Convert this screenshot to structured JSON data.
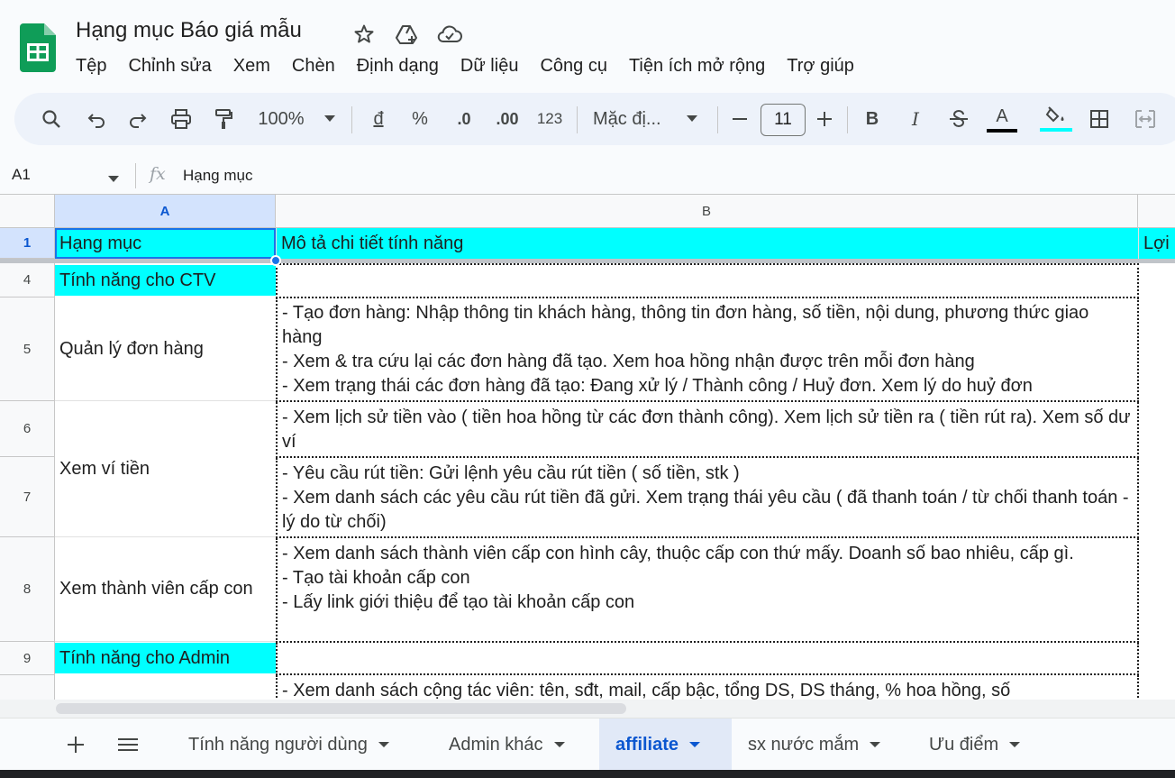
{
  "app": {
    "title": "Hạng mục Báo giá mẫu",
    "icons": [
      "sheets-logo",
      "star-icon",
      "move-to-drive-icon",
      "cloud-saved-icon"
    ]
  },
  "menu": [
    "Tệp",
    "Chỉnh sửa",
    "Xem",
    "Chèn",
    "Định dạng",
    "Dữ liệu",
    "Công cụ",
    "Tiện ích mở rộng",
    "Trợ giúp"
  ],
  "toolbar": {
    "zoom": "100%",
    "currency": "đ",
    "percent": "%",
    "decrease_decimal": ".0",
    "increase_decimal": ".00",
    "number_format": "123",
    "font": "Mặc đị...",
    "font_size": "11",
    "bold": "B",
    "italic": "I",
    "text_color_letter": "A",
    "text_color": "#000000",
    "fill_color": "#00ffff"
  },
  "formula_bar": {
    "name_box": "A1",
    "fx": "fx",
    "content": "Hạng mục"
  },
  "columns": [
    "A",
    "B"
  ],
  "rows": [
    {
      "num": "1",
      "a": "Hạng mục",
      "b": "Mô tả chi tiết tính năng",
      "c": "Lợi"
    },
    {
      "num": "4",
      "a": "Tính năng cho CTV",
      "b": ""
    },
    {
      "num": "5",
      "a": "Quản lý đơn hàng",
      "b": "- Tạo đơn hàng: Nhập thông tin khách hàng, thông tin đơn hàng, số tiền, nội dung, phương thức giao hàng\n- Xem & tra cứu lại các đơn hàng đã tạo. Xem hoa hồng nhận được trên mỗi đơn hàng\n- Xem trạng thái các đơn hàng đã tạo: Đang xử lý / Thành công / Huỷ đơn. Xem lý do huỷ đơn"
    },
    {
      "num": "6",
      "a": "Xem ví tiền",
      "b": "- Xem lịch sử tiền vào ( tiền hoa hồng từ các đơn thành công). Xem lịch sử tiền ra ( tiền rút ra). Xem số dư ví"
    },
    {
      "num": "7",
      "a": "",
      "b": "- Yêu cầu rút tiền: Gửi lệnh yêu cầu rút tiền ( số tiền, stk )\n- Xem danh sách các yêu cầu rút tiền đã gửi. Xem trạng thái yêu cầu ( đã thanh toán / từ chối thanh toán - lý do từ chối)"
    },
    {
      "num": "8",
      "a": "Xem thành viên cấp con",
      "b": "- Xem danh sách thành viên cấp con hình cây, thuộc cấp con thứ mấy. Doanh số bao nhiêu, cấp gì.\n- Tạo tài khoản cấp con\n- Lấy link giới thiệu để tạo tài khoản cấp con"
    },
    {
      "num": "9",
      "a": "Tính năng cho Admin",
      "b": ""
    },
    {
      "num": "",
      "a": "",
      "b": "- Xem danh sách cộng tác viên: tên, sđt, mail, cấp bậc, tổng DS, DS tháng, % hoa hồng, số"
    }
  ],
  "sheet_tabs": [
    {
      "label": "Tính năng người dùng",
      "active": false
    },
    {
      "label": "Admin khác",
      "active": false
    },
    {
      "label": "affiliate",
      "active": true
    },
    {
      "label": "sx nước mắm",
      "active": false
    },
    {
      "label": "Ưu điểm",
      "active": false
    }
  ],
  "colors": {
    "accent": "#0b57d0",
    "highlight": "#00ffff",
    "selection": "#1a73e8",
    "sheets_green": "#0f9d58"
  }
}
